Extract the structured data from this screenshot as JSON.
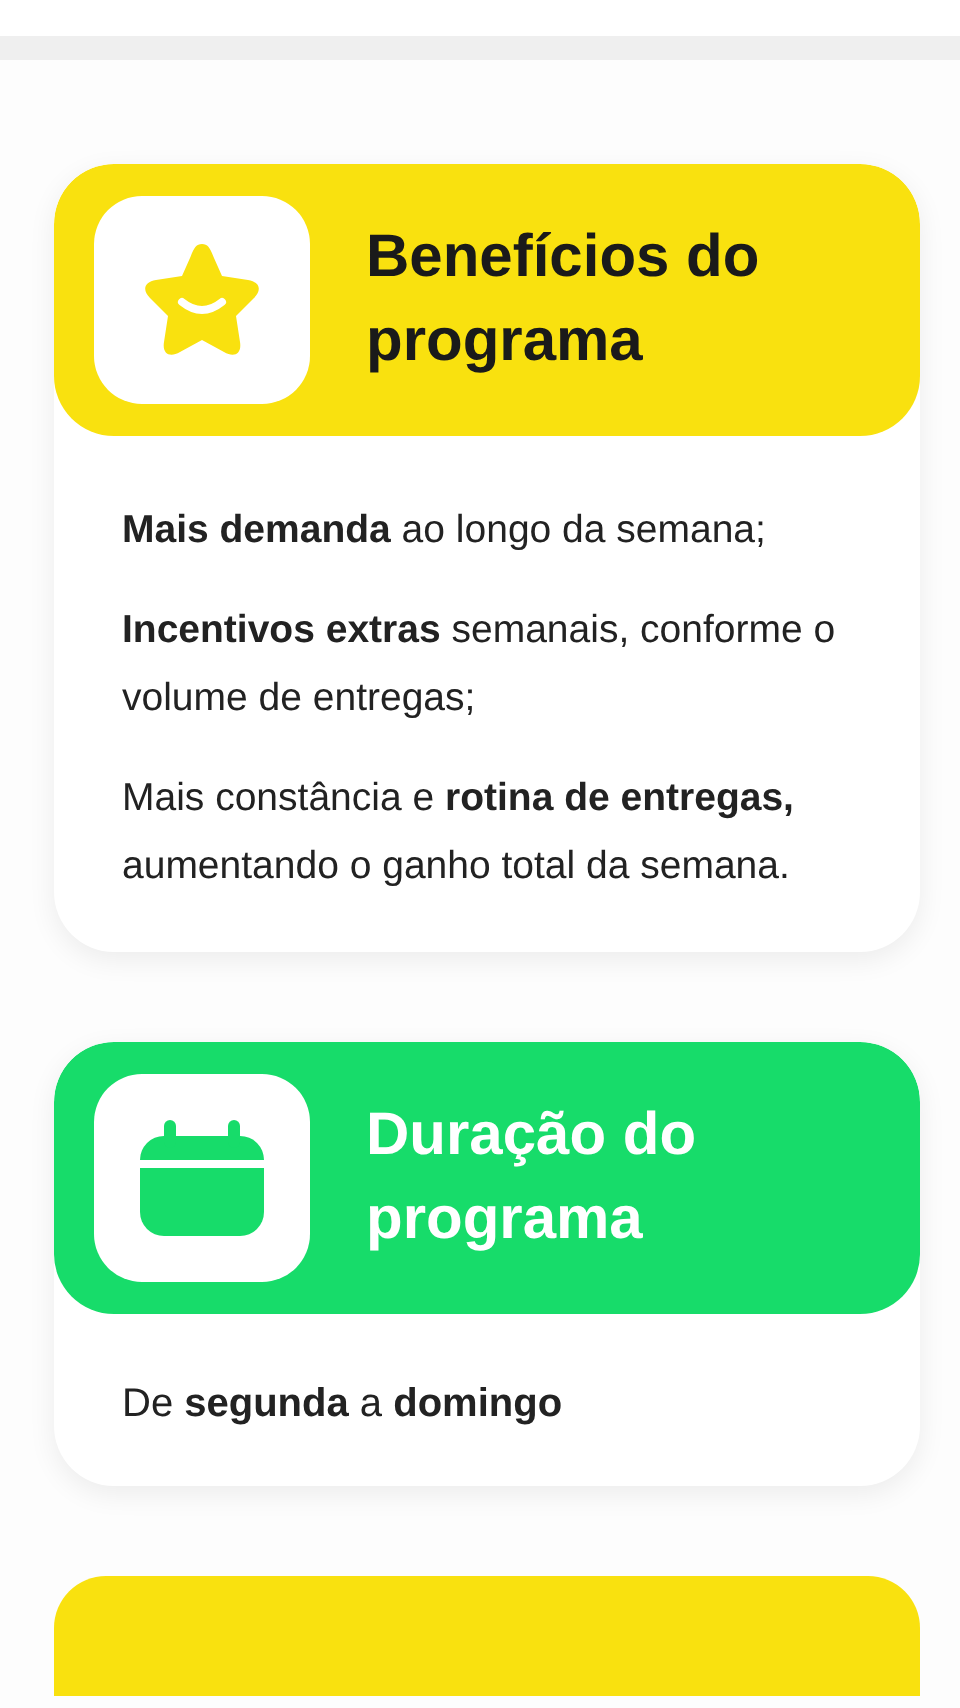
{
  "sections": [
    {
      "kind": "star",
      "color": "#f9e10f",
      "title": "Benefícios do programa",
      "title_light": false,
      "paragraphs": [
        "**Mais demanda** ao longo da semana;",
        "**Incentivos extras** semanais, conforme o volume de entregas;",
        "Mais constância e **rotina de entregas,** aumentando o ganho total da semana."
      ]
    },
    {
      "kind": "calendar",
      "color": "#17dc6a",
      "title": "Duração do programa",
      "title_light": true,
      "paragraphs": [
        "De **segunda** a **domingo**"
      ]
    },
    {
      "kind": "partial",
      "color": "#f9e10f"
    }
  ]
}
